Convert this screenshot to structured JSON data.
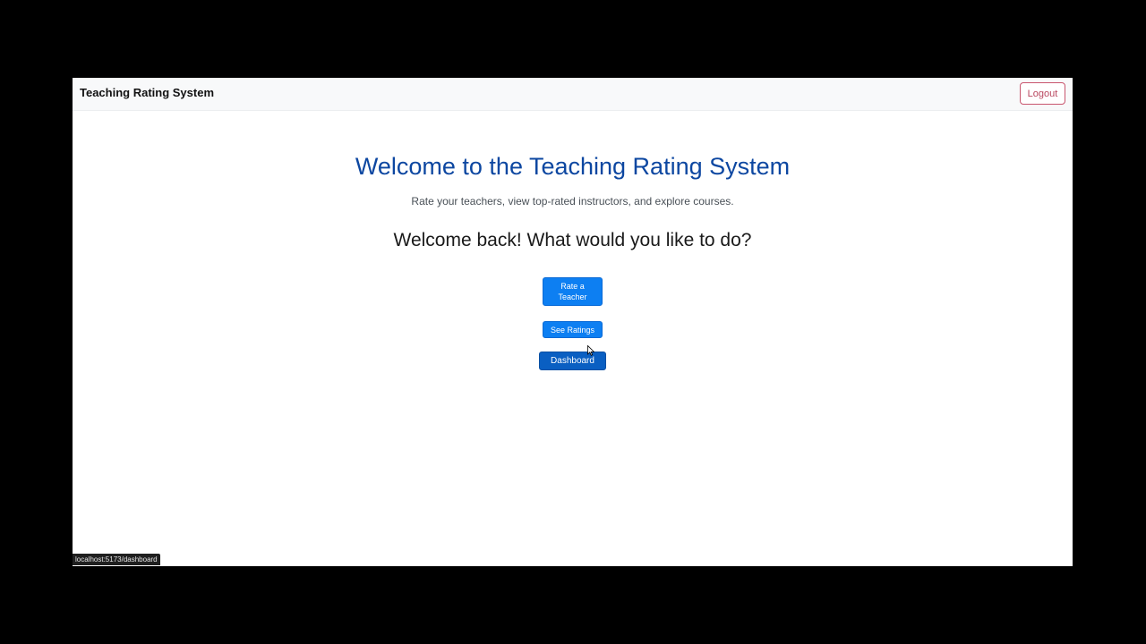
{
  "navbar": {
    "brand": "Teaching Rating System",
    "logout_label": "Logout"
  },
  "hero": {
    "title": "Welcome to the Teaching Rating System",
    "subtitle": "Rate your teachers, view top-rated instructors, and explore courses."
  },
  "actions": {
    "heading": "Welcome back! What would you like to do?",
    "rate_label": "Rate a Teacher",
    "see_label": "See Ratings",
    "dashboard_label": "Dashboard"
  },
  "status_bar": {
    "url": "localhost:5173/dashboard"
  },
  "colors": {
    "title": "#0d47a1",
    "primary_button": "#0d7ff2",
    "logout": "#b9475f"
  },
  "icons": {
    "cursor": "mouse-pointer-icon"
  }
}
